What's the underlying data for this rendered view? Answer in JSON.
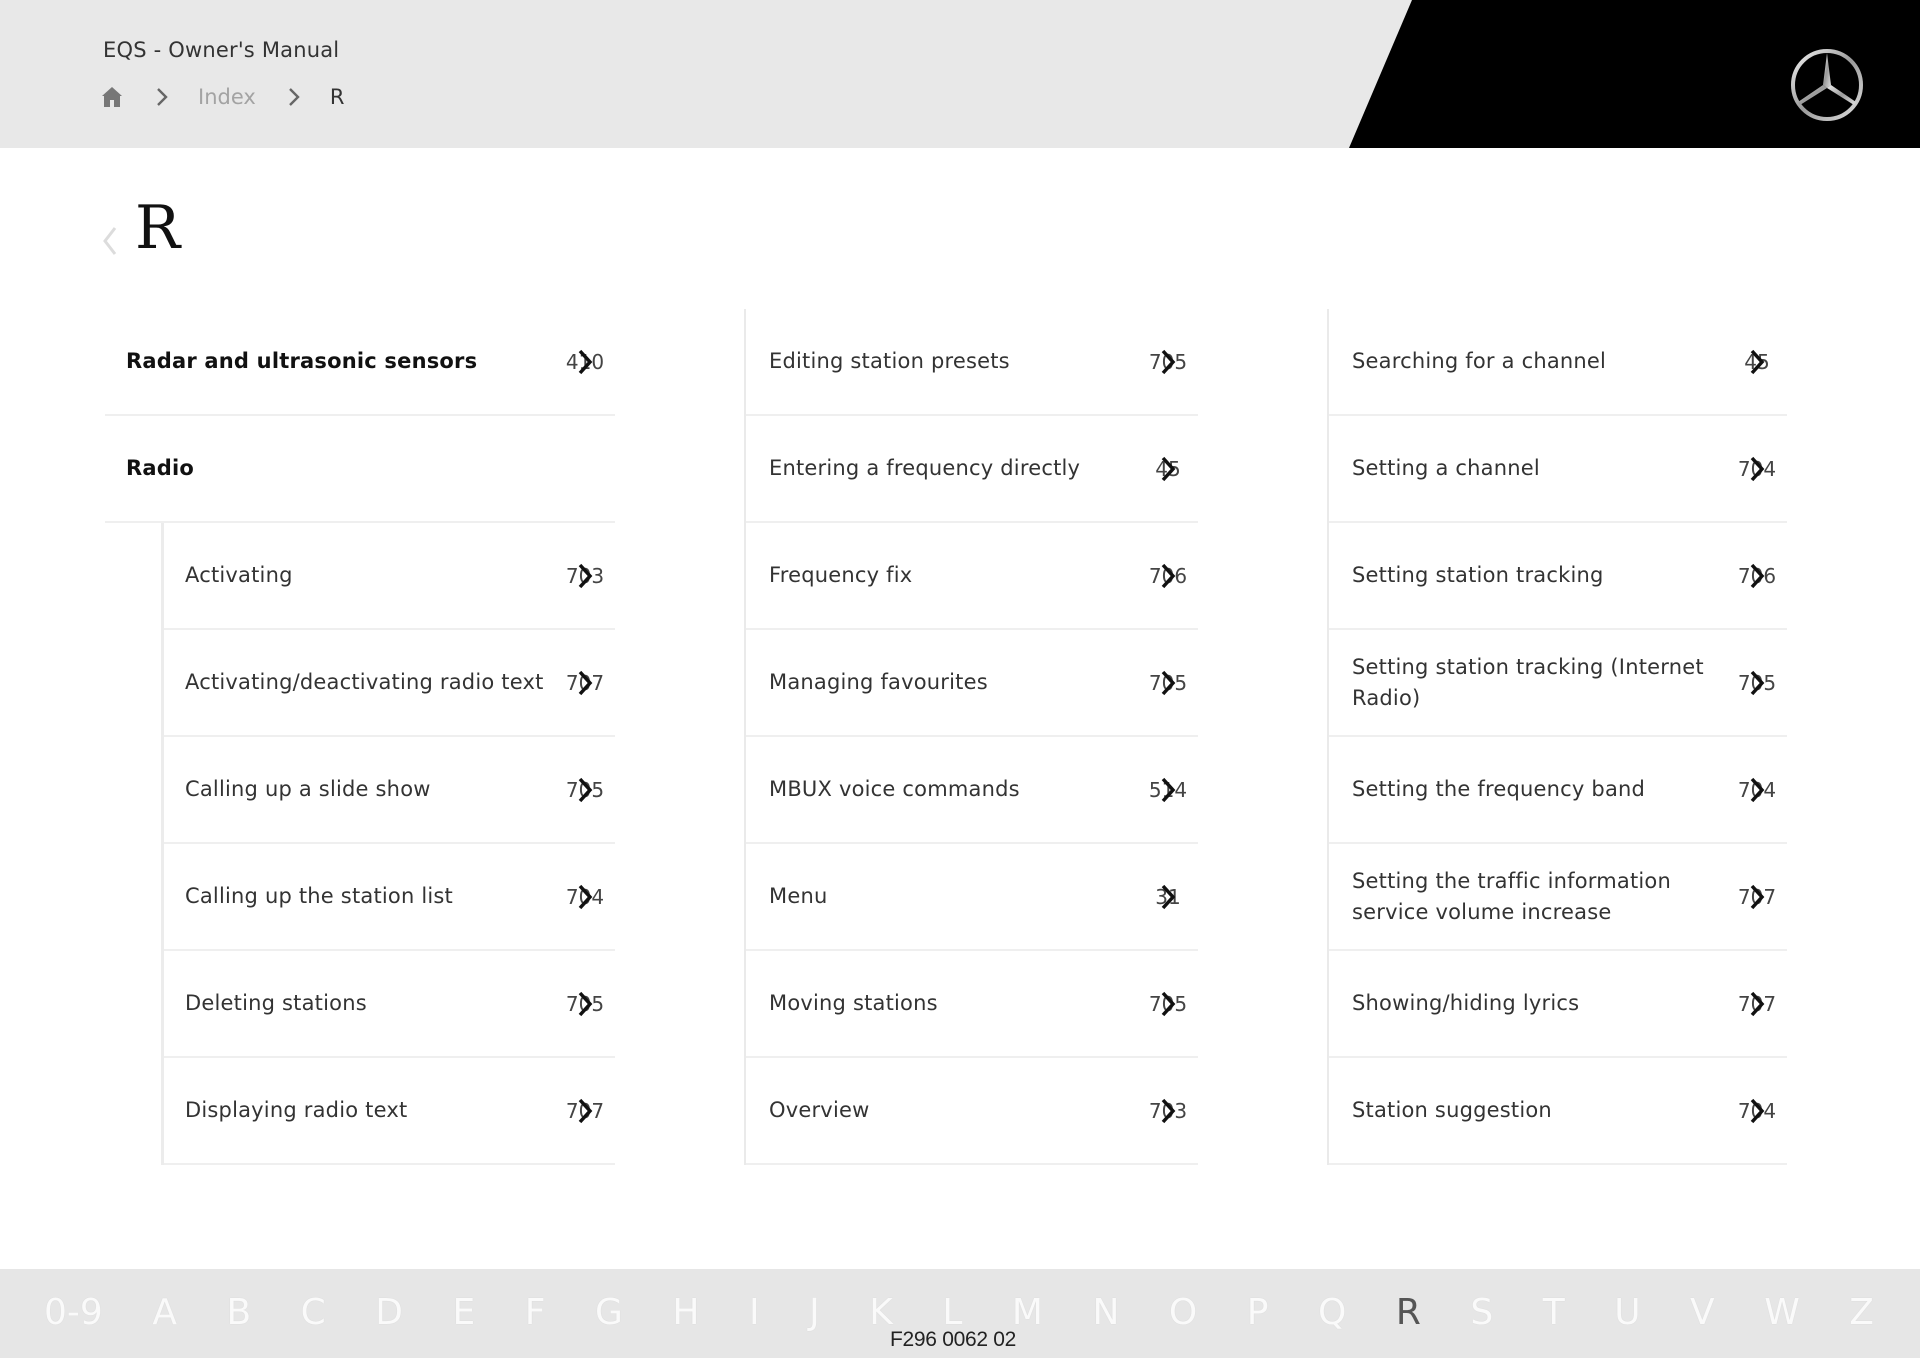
{
  "header": {
    "doc_title": "EQS - Owner's Manual",
    "breadcrumb": {
      "home_icon": "home-icon",
      "items": [
        "Index",
        "R"
      ]
    },
    "logo": "mercedes-star-logo"
  },
  "section": {
    "letter": "R",
    "back_icon": "chevron-left-icon"
  },
  "columns": [
    {
      "entries": [
        {
          "label": "Radar and ultrasonic sensors",
          "page": "410",
          "bold": true
        },
        {
          "label": "Radio",
          "page": "",
          "bold": true
        }
      ],
      "sub_entries": [
        {
          "label": "Activating",
          "page": "703"
        },
        {
          "label": "Activating/deactivating radio text",
          "page": "707"
        },
        {
          "label": "Calling up a slide show",
          "page": "705"
        },
        {
          "label": "Calling up the station list",
          "page": "704"
        },
        {
          "label": "Deleting stations",
          "page": "705"
        },
        {
          "label": "Displaying radio text",
          "page": "707"
        }
      ]
    },
    {
      "entries": [
        {
          "label": "Editing station presets",
          "page": "705"
        },
        {
          "label": "Entering a frequency directly",
          "page": "45"
        },
        {
          "label": "Frequency fix",
          "page": "706"
        },
        {
          "label": "Managing favourites",
          "page": "705"
        },
        {
          "label": "MBUX voice commands",
          "page": "514"
        },
        {
          "label": "Menu",
          "page": "31"
        },
        {
          "label": "Moving stations",
          "page": "705"
        },
        {
          "label": "Overview",
          "page": "703"
        }
      ]
    },
    {
      "entries": [
        {
          "label": "Searching for a channel",
          "page": "45"
        },
        {
          "label": "Setting a channel",
          "page": "704"
        },
        {
          "label": "Setting station tracking",
          "page": "706"
        },
        {
          "label": "Setting station tracking (Internet Radio)",
          "page": "705"
        },
        {
          "label": "Setting the frequency band",
          "page": "704"
        },
        {
          "label": "Setting the traffic information service volume increase",
          "page": "707"
        },
        {
          "label": "Showing/hiding lyrics",
          "page": "707"
        },
        {
          "label": "Station suggestion",
          "page": "704"
        }
      ]
    }
  ],
  "alphabet": {
    "letters": [
      "0-9",
      "A",
      "B",
      "C",
      "D",
      "E",
      "F",
      "G",
      "H",
      "I",
      "J",
      "K",
      "L",
      "M",
      "N",
      "O",
      "P",
      "Q",
      "R",
      "S",
      "T",
      "U",
      "V",
      "W",
      "Z"
    ],
    "active": "R"
  },
  "doc_code": "F296 0062 02"
}
